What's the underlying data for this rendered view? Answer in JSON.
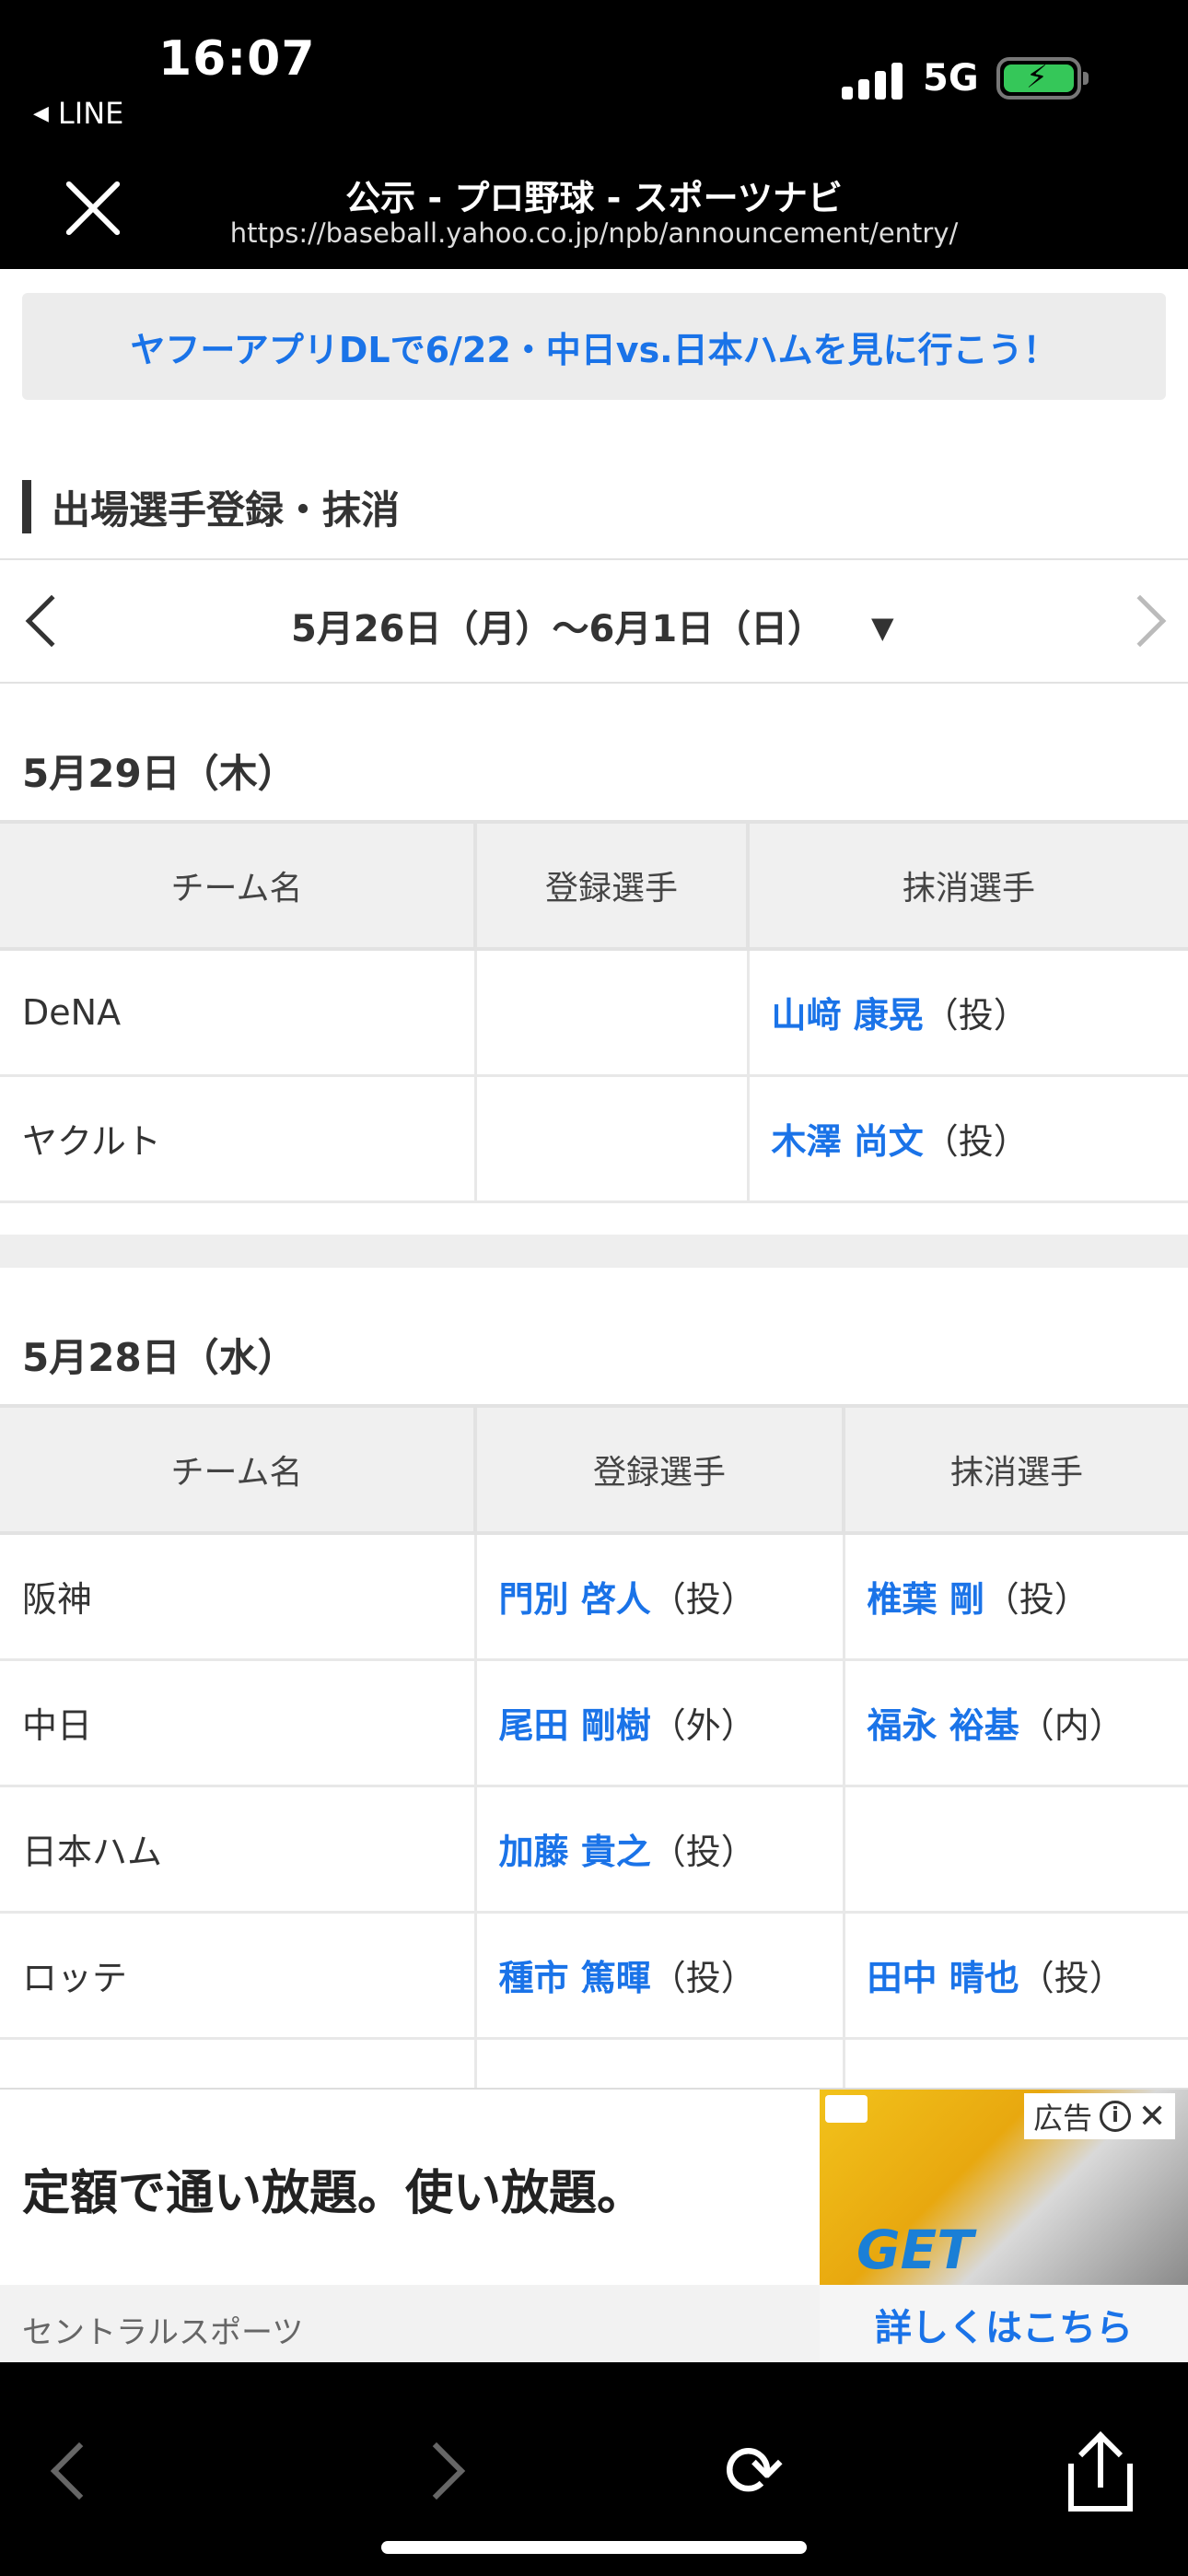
{
  "status_bar": {
    "time": "16:07",
    "back_app": "LINE",
    "network": "5G",
    "battery_charging": true
  },
  "header": {
    "title": "公示 - プロ野球 - スポーツナビ",
    "url": "https://baseball.yahoo.co.jp/npb/announcement/entry/"
  },
  "promo": {
    "text": "ヤフーアプリDLで6/22・中日vs.日本ハムを見に行こう！"
  },
  "section": {
    "title": "出場選手登録・抹消"
  },
  "week_nav": {
    "label": "5月26日（月）〜6月1日（日）"
  },
  "days": [
    {
      "date": "5月29日（木）",
      "headers": [
        "チーム名",
        "登録選手",
        "抹消選手"
      ],
      "rows": [
        {
          "team": "DeNA",
          "registered": {
            "name": "",
            "pos": ""
          },
          "deregistered": {
            "name": "山﨑 康晃",
            "pos": "（投）"
          }
        },
        {
          "team": "ヤクルト",
          "registered": {
            "name": "",
            "pos": ""
          },
          "deregistered": {
            "name": "木澤 尚文",
            "pos": "（投）"
          }
        }
      ]
    },
    {
      "date": "5月28日（水）",
      "headers": [
        "チーム名",
        "登録選手",
        "抹消選手"
      ],
      "rows": [
        {
          "team": "阪神",
          "registered": {
            "name": "門別 啓人",
            "pos": "（投）"
          },
          "deregistered": {
            "name": "椎葉 剛",
            "pos": "（投）"
          }
        },
        {
          "team": "中日",
          "registered": {
            "name": "尾田 剛樹",
            "pos": "（外）"
          },
          "deregistered": {
            "name": "福永 裕基",
            "pos": "（内）"
          }
        },
        {
          "team": "日本ハム",
          "registered": {
            "name": "加藤 貴之",
            "pos": "（投）"
          },
          "deregistered": {
            "name": "",
            "pos": ""
          }
        },
        {
          "team": "ロッテ",
          "registered": {
            "name": "種市 篤暉",
            "pos": "（投）"
          },
          "deregistered": {
            "name": "田中 晴也",
            "pos": "（投）"
          }
        }
      ]
    }
  ],
  "ad": {
    "headline": "定額で通い放題。使い放題。",
    "sponsor": "セントラルスポーツ",
    "label": "広告",
    "cta": "詳しくはこちら",
    "image_text": "GET READY"
  },
  "toolbar": {
    "icons": [
      "back-icon",
      "forward-icon",
      "reload-icon",
      "share-icon"
    ]
  }
}
